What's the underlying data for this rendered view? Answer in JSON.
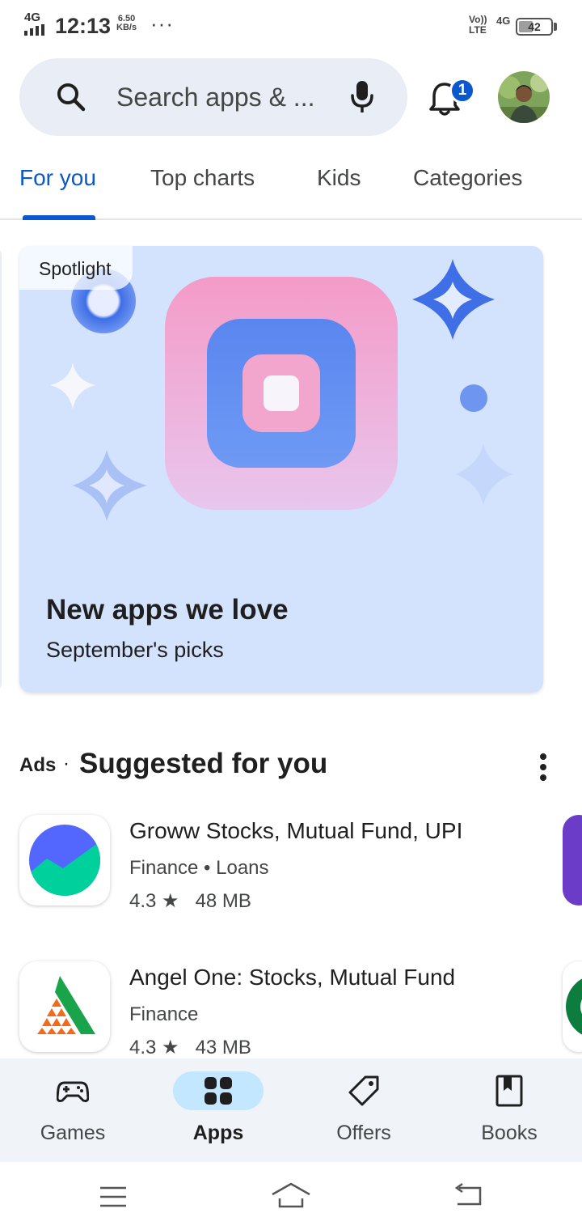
{
  "status_bar": {
    "network": "4G",
    "time": "12:13",
    "speed_value": "6.50",
    "speed_unit": "KB/s",
    "more": "···",
    "volte": "Vo))",
    "lte": "LTE",
    "network_right": "4G",
    "battery": "42"
  },
  "search": {
    "placeholder": "Search apps & ..."
  },
  "notifications": {
    "badge": "1"
  },
  "tabs": [
    {
      "label": "For you",
      "active": true
    },
    {
      "label": "Top charts"
    },
    {
      "label": "Kids"
    },
    {
      "label": "Categories"
    }
  ],
  "spotlight": {
    "chip": "Spotlight",
    "title": "New apps we love",
    "subtitle": "September's picks"
  },
  "suggested": {
    "ads_label": "Ads",
    "separator": "·",
    "title": "Suggested for you",
    "apps": [
      {
        "name": "Groww Stocks, Mutual Fund, UPI",
        "categories": "Finance  •  Loans",
        "rating": "4.3 ★",
        "size": "48 MB"
      },
      {
        "name": "Angel One: Stocks, Mutual Fund",
        "categories": "Finance",
        "rating": "4.3 ★",
        "size": "43 MB"
      }
    ]
  },
  "bottom_nav": [
    {
      "label": "Games",
      "icon": "gamepad-icon"
    },
    {
      "label": "Apps",
      "icon": "apps-grid-icon",
      "active": true
    },
    {
      "label": "Offers",
      "icon": "tag-icon"
    },
    {
      "label": "Books",
      "icon": "bookmark-book-icon"
    }
  ],
  "colors": {
    "accent": "#0b57d0",
    "spotlight_bg": "#d3e2fd",
    "search_bg": "#e9eef6",
    "nav_bg": "#f0f4f9",
    "active_pill": "#c2e7ff"
  }
}
